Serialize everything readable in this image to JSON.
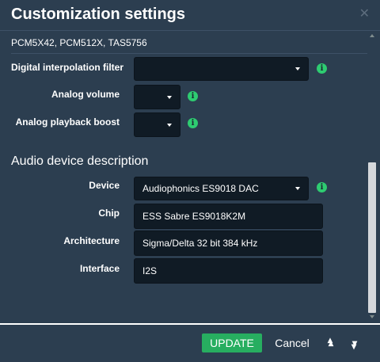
{
  "dialog": {
    "title": "Customization settings",
    "close_icon": "close-icon"
  },
  "dac": {
    "chip_list": "PCM5X42, PCM512X, TAS5756",
    "interpolation_label": "Digital interpolation filter",
    "interpolation_value": "",
    "analog_volume_label": "Analog volume",
    "analog_volume_value": "",
    "analog_boost_label": "Analog playback boost",
    "analog_boost_value": ""
  },
  "audio_device": {
    "section_title": "Audio device description",
    "device_label": "Device",
    "device_value": "Audiophonics ES9018 DAC",
    "chip_label": "Chip",
    "chip_value": "ESS Sabre ES9018K2M",
    "architecture_label": "Architecture",
    "architecture_value": "Sigma/Delta 32 bit 384 kHz",
    "interface_label": "Interface",
    "interface_value": "I2S"
  },
  "footer": {
    "update_label": "UPDATE",
    "cancel_label": "Cancel",
    "scroll_top_icon": "double-chevron-up-icon",
    "scroll_bottom_icon": "double-chevron-down-icon"
  },
  "colors": {
    "accent": "#27ae60",
    "info": "#2ecc71",
    "background": "#2c3e50",
    "field": "#101b25"
  }
}
